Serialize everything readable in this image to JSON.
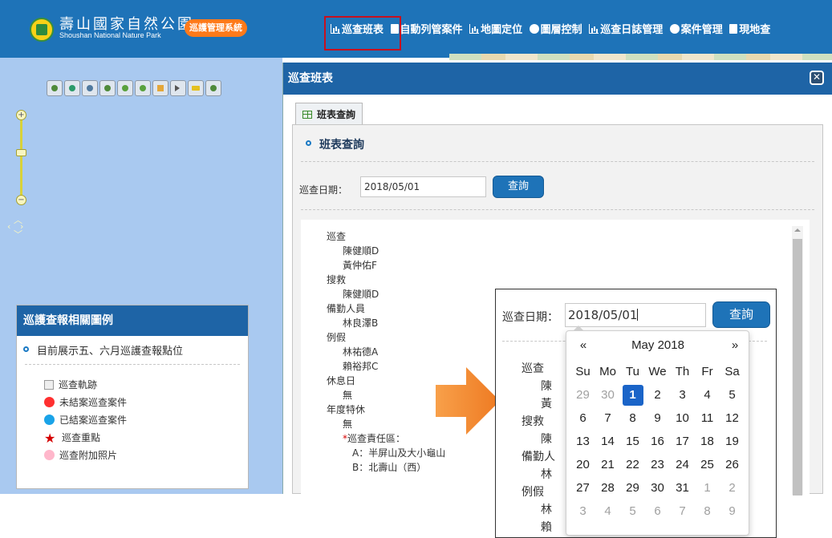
{
  "header": {
    "logo_title": "壽山國家自然公園",
    "logo_subtitle": "Shoushan National Nature Park",
    "system_badge": "巡護管理系統",
    "nav": [
      {
        "label": "巡查班表",
        "icon": "bar-chart-icon"
      },
      {
        "label": "自動列管案件",
        "icon": "document-icon"
      },
      {
        "label": "地圖定位",
        "icon": "bar-chart-icon"
      },
      {
        "label": "圖層控制",
        "icon": "layers-icon"
      },
      {
        "label": "巡查日誌管理",
        "icon": "bar-chart-icon"
      },
      {
        "label": "案件管理",
        "icon": "layers-icon"
      },
      {
        "label": "現地查",
        "icon": "document-icon"
      }
    ]
  },
  "map": {
    "zoom_in": "+",
    "zoom_out": "−"
  },
  "legend": {
    "title": "巡護查報相關圖例",
    "description": "目前展示五、六月巡護查報點位",
    "items": [
      {
        "label": "巡查軌跡",
        "icon": "broken-image-icon"
      },
      {
        "label": "未結案巡查案件",
        "icon": "red-dot-icon",
        "color": "#ff3030"
      },
      {
        "label": "已結案巡查案件",
        "icon": "blue-dot-icon",
        "color": "#1aa3e8"
      },
      {
        "label": "巡查重點",
        "icon": "star-icon",
        "color": "#d50000"
      },
      {
        "label": "巡查附加照片",
        "icon": "pink-dot-icon",
        "color": "#ffb7cb"
      }
    ]
  },
  "dialog": {
    "title": "巡查班表",
    "tab_label": "班表查詢",
    "panel_heading": "班表查詢",
    "date_label": "巡查日期：",
    "date_value": "2018/05/01",
    "query_button": "查詢",
    "results": {
      "patrol": "巡查",
      "patrol_members": [
        "陳健順D",
        "黃仲佑F"
      ],
      "rescue": "搜救",
      "rescue_members": [
        "陳健順D"
      ],
      "standby": "備勤人員",
      "standby_members": [
        "林良澤B"
      ],
      "dayoff": "例假",
      "dayoff_members": [
        "林祐德A",
        "賴裕邦C"
      ],
      "rest": "休息日",
      "rest_members": [
        "無"
      ],
      "annual": "年度特休",
      "annual_members": [
        "無"
      ],
      "zones_title": "巡查責任區：",
      "zones": [
        "A：半屏山及大小龜山",
        "B：北壽山（西）"
      ]
    }
  },
  "inset": {
    "date_label": "巡查日期：",
    "date_value": "2018/05/01",
    "query_button": "查詢",
    "list": [
      "巡查",
      "陳",
      "黃",
      "搜救",
      "陳",
      "備勤人",
      "林",
      "例假",
      "林",
      "賴"
    ]
  },
  "datepicker": {
    "prev": "«",
    "next": "»",
    "month_title": "May 2018",
    "weekdays": [
      "Su",
      "Mo",
      "Tu",
      "We",
      "Th",
      "Fr",
      "Sa"
    ],
    "weeks": [
      [
        "29",
        "30",
        "1",
        "2",
        "3",
        "4",
        "5"
      ],
      [
        "6",
        "7",
        "8",
        "9",
        "10",
        "11",
        "12"
      ],
      [
        "13",
        "14",
        "15",
        "16",
        "17",
        "18",
        "19"
      ],
      [
        "20",
        "21",
        "22",
        "23",
        "24",
        "25",
        "26"
      ],
      [
        "27",
        "28",
        "29",
        "30",
        "31",
        "1",
        "2"
      ],
      [
        "3",
        "4",
        "5",
        "6",
        "7",
        "8",
        "9"
      ]
    ],
    "selected": "1"
  },
  "colors": {
    "header_bg": "#1e73b8",
    "title_bar_bg": "#1e64a6",
    "accent_orange": "#ff7a1a",
    "highlight_red": "#c8101e",
    "selected_day": "#1a64c8"
  }
}
